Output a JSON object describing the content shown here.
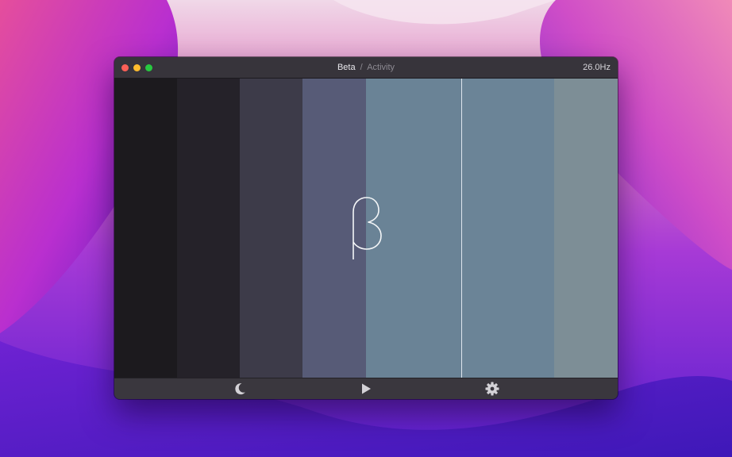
{
  "window": {
    "title": "Beta",
    "title_separator": "/",
    "subtitle": "Activity",
    "frequency": "26.0",
    "frequency_unit": "Hz"
  },
  "visualization": {
    "symbol": "greek-small-beta-glyph",
    "band_colors": [
      "#1c1a1e",
      "#252229",
      "#3d3b49",
      "#575b77",
      "#6a8396",
      "#6b8497",
      "#7d8e96"
    ],
    "marker_color": "#dfe6ee"
  },
  "toolbar": {
    "icons": [
      "moon-icon",
      "play-icon",
      "gear-icon"
    ],
    "icon_color": "#d4d2d7"
  },
  "traffic_lights": {
    "close_color": "#fe5f57",
    "minimize_color": "#febc2e",
    "zoom_color": "#28c840"
  }
}
